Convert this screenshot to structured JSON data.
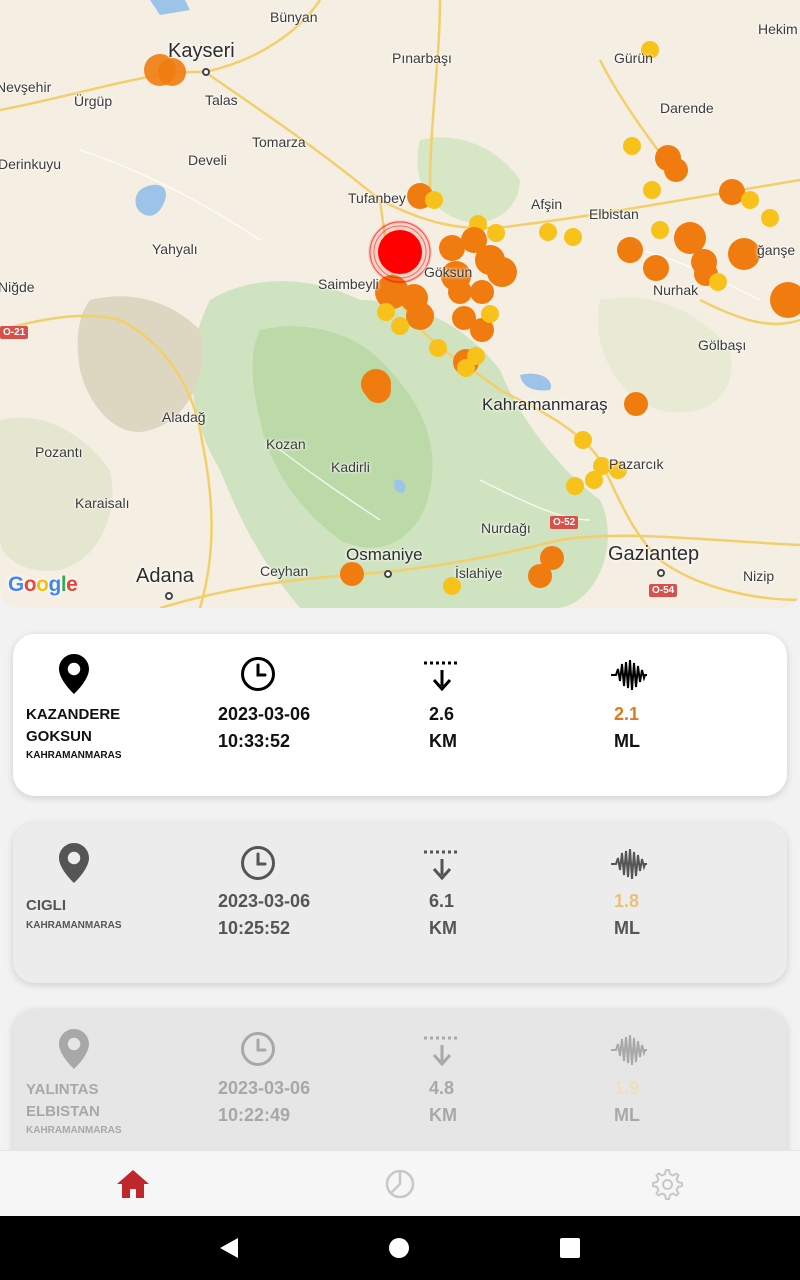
{
  "map": {
    "provider_logo": "Google",
    "labels": {
      "kayseri": "Kayseri",
      "bunyan": "Bünyan",
      "nevsehir": "Nevşehir",
      "urgup": "Ürgüp",
      "talas": "Talas",
      "pinarbasi": "Pınarbaşı",
      "gurun": "Gürün",
      "hekimhan": "Hekim",
      "darende": "Darende",
      "derinkuyu": "Derinkuyu",
      "tomarza": "Tomarza",
      "develi": "Develi",
      "tufanbeyli": "Tufanbey",
      "afsin": "Afşin",
      "elbistan": "Elbistan",
      "dogansehir": "ğanşe",
      "yahyali": "Yahyalı",
      "nigde": "Niğde",
      "saimbeyli": "Saimbeyli",
      "goksun": "Göksun",
      "nurhak": "Nurhak",
      "golbasi": "Gölbaşı",
      "aladag": "Aladağ",
      "kahramanmaras": "Kahramanmaraş",
      "pozanti": "Pozantı",
      "kozan": "Kozan",
      "kadirli": "Kadirli",
      "pazarcik": "Pazarcık",
      "karaisali": "Karaisalı",
      "nurdagi": "Nurdağı",
      "adana": "Adana",
      "ceyhan": "Ceyhan",
      "osmaniye": "Osmaniye",
      "islahiye": "İslahiye",
      "gaziantep": "Gaziantep",
      "nizip": "Nizip",
      "road_o21": "O-21",
      "road_o52": "O-52",
      "road_o54": "O-54"
    }
  },
  "earthquakes": [
    {
      "location": "KAZANDERE",
      "location_line2": "GOKSUN",
      "region": "KAHRAMANMARAS",
      "date": "2023-03-06",
      "time": "10:33:52",
      "depth": "2.6",
      "depth_unit": "KM",
      "magnitude": "2.1",
      "magnitude_unit": "ML"
    },
    {
      "location": "CIGLI",
      "location_line2": "",
      "region": "KAHRAMANMARAS",
      "date": "2023-03-06",
      "time": "10:25:52",
      "depth": "6.1",
      "depth_unit": "KM",
      "magnitude": "1.8",
      "magnitude_unit": "ML"
    },
    {
      "location": "YALINTAS",
      "location_line2": "ELBISTAN",
      "region": "KAHRAMANMARAS",
      "date": "2023-03-06",
      "time": "10:22:49",
      "depth": "4.8",
      "depth_unit": "KM",
      "magnitude": "1.9",
      "magnitude_unit": "ML"
    }
  ],
  "icons": {
    "location": "location-pin-icon",
    "time": "clock-icon",
    "depth": "depth-arrow-icon",
    "magnitude": "seismic-wave-icon"
  },
  "nav": {
    "items": [
      {
        "icon": "home-icon",
        "active": true
      },
      {
        "icon": "history-icon",
        "active": false
      },
      {
        "icon": "settings-icon",
        "active": false
      }
    ],
    "active_color": "#c0272d",
    "inactive_color": "#c8c8c8"
  },
  "system_bar": {
    "back": "back-icon",
    "home": "home-circle-icon",
    "recents": "recents-icon"
  },
  "colors": {
    "epicenter": "#ff0000",
    "quake_orange": "#f07c10",
    "quake_yellow": "#f7c21a",
    "magnitude_text": "#e07a1f"
  }
}
